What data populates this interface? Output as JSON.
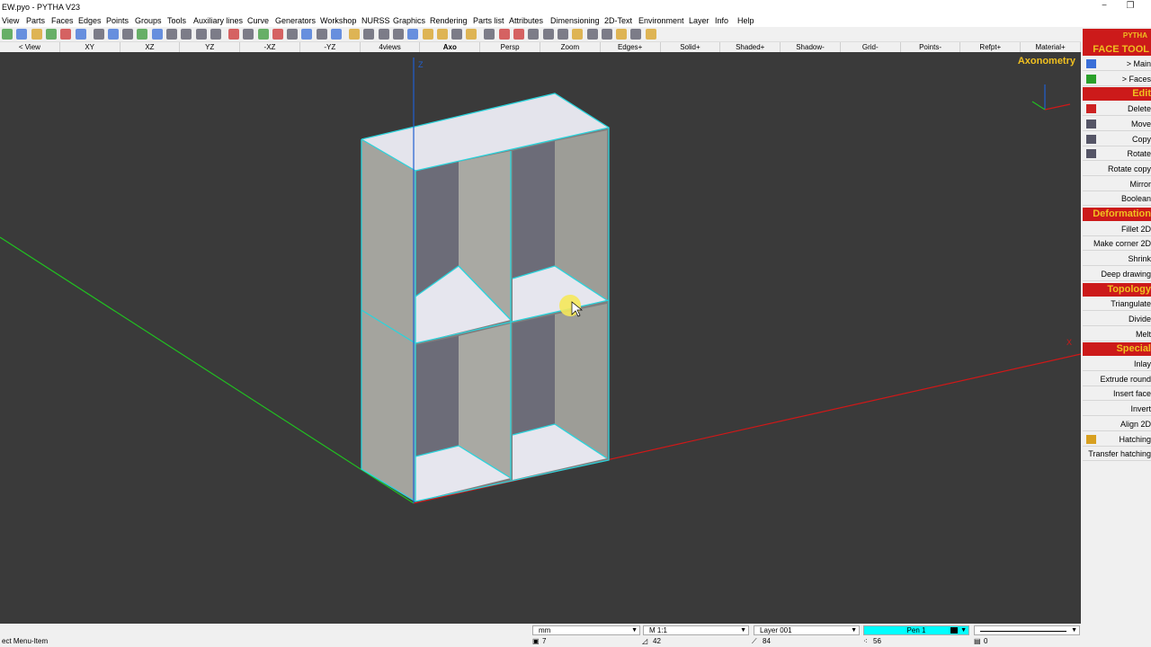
{
  "window": {
    "title": "EW.pyo - PYTHA V23",
    "minimize": "−",
    "restore": "❐"
  },
  "menu": [
    "View",
    "Parts",
    "Faces",
    "Edges",
    "Points",
    "Groups",
    "Tools",
    "Auxiliary lines",
    "Curve",
    "Generators",
    "Workshop",
    "NURSS",
    "Graphics",
    "Rendering",
    "Parts list",
    "Attributes",
    "Dimensioning",
    "2D-Text",
    "Environment",
    "Layer",
    "Info",
    "Help"
  ],
  "views": [
    "< View",
    "XY",
    "XZ",
    "YZ",
    "-XZ",
    "-YZ",
    "4views",
    "Axo",
    "Persp",
    "Zoom",
    "Edges+",
    "Solid+",
    "Shaded+",
    "Shadow-",
    "Grid-",
    "Points-",
    "Refpt+",
    "Material+"
  ],
  "viewport": {
    "label": "Axonometry",
    "axis_z": "Z",
    "axis_x": "X"
  },
  "panel": {
    "logo_small": "PYTHA",
    "logo_title": "FACE TOOL",
    "items": [
      {
        "type": "btn",
        "label": "> Main",
        "icon": "home-icon",
        "color": "#3a6fd8"
      },
      {
        "type": "btn",
        "label": "> Faces",
        "icon": "faces-icon",
        "color": "#2aa02a"
      },
      {
        "type": "head",
        "label": "Edit"
      },
      {
        "type": "btn",
        "label": "Delete",
        "icon": "delete-icon",
        "color": "#cc2222"
      },
      {
        "type": "btn",
        "label": "Move",
        "icon": "move-icon",
        "color": "#556"
      },
      {
        "type": "btn",
        "label": "Copy",
        "icon": "copy-icon",
        "color": "#556"
      },
      {
        "type": "btn",
        "label": "Rotate",
        "icon": "rotate-icon",
        "color": "#556"
      },
      {
        "type": "btn",
        "label": "Rotate copy"
      },
      {
        "type": "btn",
        "label": "Mirror"
      },
      {
        "type": "btn",
        "label": "Boolean"
      },
      {
        "type": "head",
        "label": "Deformation"
      },
      {
        "type": "btn",
        "label": "Fillet 2D"
      },
      {
        "type": "btn",
        "label": "Make corner 2D"
      },
      {
        "type": "btn",
        "label": "Shrink"
      },
      {
        "type": "btn",
        "label": "Deep drawing"
      },
      {
        "type": "head",
        "label": "Topology"
      },
      {
        "type": "btn",
        "label": "Triangulate"
      },
      {
        "type": "btn",
        "label": "Divide"
      },
      {
        "type": "btn",
        "label": "Melt"
      },
      {
        "type": "head",
        "label": "Special"
      },
      {
        "type": "btn",
        "label": "Inlay"
      },
      {
        "type": "btn",
        "label": "Extrude round"
      },
      {
        "type": "btn",
        "label": "Insert face"
      },
      {
        "type": "btn",
        "label": "Invert"
      },
      {
        "type": "btn",
        "label": "Align 2D"
      },
      {
        "type": "btn",
        "label": "Hatching",
        "icon": "hatching-icon",
        "color": "#d8a020"
      },
      {
        "type": "btn",
        "label": "Transfer hatching"
      }
    ]
  },
  "status": {
    "hint": "ect Menu-Item",
    "unit": "mm",
    "scale": "M 1:1",
    "layer": "Layer 001",
    "pen": "Pen 1",
    "parts": "7",
    "faces": "42",
    "edges": "84",
    "points": "56",
    "groups": "0"
  },
  "colors": {
    "accent_red": "#cc1a1a",
    "accent_yellow": "#f0c020",
    "selection_cyan": "#2ad4dc",
    "pen_cyan": "#00ffff"
  }
}
